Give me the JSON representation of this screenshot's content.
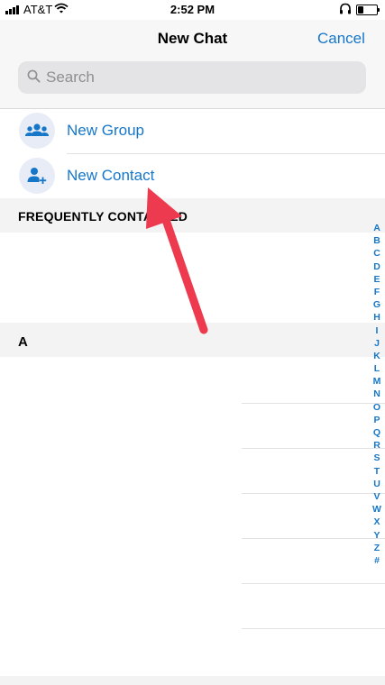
{
  "status_bar": {
    "carrier": "AT&T",
    "time": "2:52 PM"
  },
  "header": {
    "title": "New Chat",
    "cancel_label": "Cancel"
  },
  "search": {
    "placeholder": "Search"
  },
  "actions": [
    {
      "label": "New Group",
      "icon": "group-icon"
    },
    {
      "label": "New Contact",
      "icon": "add-contact-icon"
    }
  ],
  "sections": {
    "frequently_contacted": "FREQUENTLY CONTACTED",
    "a": "A"
  },
  "alphabet_index": [
    "A",
    "B",
    "C",
    "D",
    "E",
    "F",
    "G",
    "H",
    "I",
    "J",
    "K",
    "L",
    "M",
    "N",
    "O",
    "P",
    "Q",
    "R",
    "S",
    "T",
    "U",
    "V",
    "W",
    "X",
    "Y",
    "Z",
    "#"
  ],
  "colors": {
    "accent": "#1677c9",
    "arrow": "#ee3a4e",
    "section_bg": "#f3f3f3"
  }
}
